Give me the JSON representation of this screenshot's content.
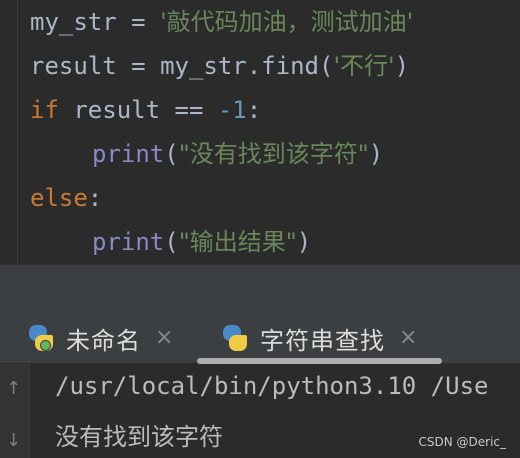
{
  "editor": {
    "line1": {
      "var": "my_str",
      "op": " = ",
      "str": "'敲代码加油，测试加油'"
    },
    "line2": {
      "var": "result",
      "op": " = ",
      "call": "my_str.find(",
      "str": "'不行'",
      "close": ")"
    },
    "line3": {
      "kw": "if",
      "rest": " result == ",
      "num": "-1",
      "colon": ":"
    },
    "line4": {
      "fn": "print",
      "open": "(",
      "str": "\"没有找到该字符\"",
      "close": ")"
    },
    "line5": {
      "kw": "else",
      "colon": ":"
    },
    "line6": {
      "fn": "print",
      "open": "(",
      "str": "\"输出结果\"",
      "close": ")"
    }
  },
  "run_tabs": [
    {
      "label": "未命名",
      "icon": "python-icon",
      "close": "×"
    },
    {
      "label": "字符串查找",
      "icon": "python-icon",
      "close": "×"
    }
  ],
  "console": {
    "command": "/usr/local/bin/python3.10 /Use",
    "output": "没有找到该字符",
    "up_arrow": "↑",
    "down_arrow": "↓"
  },
  "watermark": "CSDN @Deric_",
  "colors": {
    "keyword": "#cc7832",
    "string": "#6a8759",
    "number": "#6897bb",
    "builtin": "#8888c6",
    "text": "#a9b7c6",
    "background": "#2b2b2b"
  }
}
